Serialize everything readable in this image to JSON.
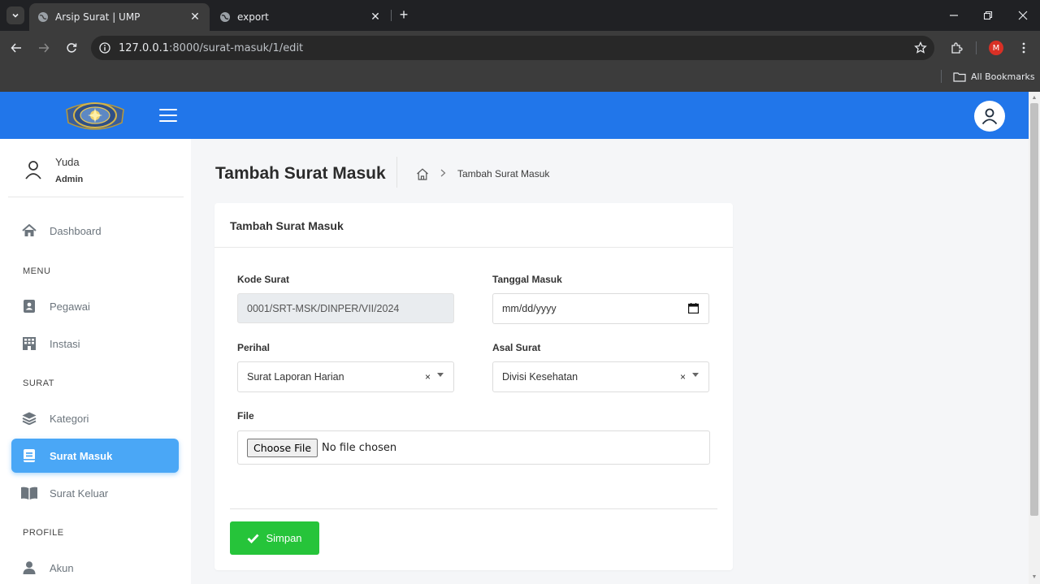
{
  "browser": {
    "tabs": [
      {
        "title": "Arsip Surat | UMP",
        "active": true
      },
      {
        "title": "export",
        "active": false
      }
    ],
    "url_host": "127.0.0.1",
    "url_rest": ":8000/surat-masuk/1/edit",
    "profile_initial": "M",
    "bookmarks_label": "All Bookmarks"
  },
  "sidebar": {
    "user_name": "Yuda",
    "user_role": "Admin",
    "items": {
      "dashboard": "Dashboard",
      "pegawai": "Pegawai",
      "instasi": "Instasi",
      "kategori": "Kategori",
      "surat_masuk": "Surat Masuk",
      "surat_keluar": "Surat Keluar",
      "akun": "Akun"
    },
    "headings": {
      "menu": "MENU",
      "surat": "SURAT",
      "profile": "PROFILE"
    }
  },
  "page": {
    "title": "Tambah Surat Masuk",
    "breadcrumb_current": "Tambah Surat Masuk"
  },
  "form": {
    "card_title": "Tambah Surat Masuk",
    "kode_label": "Kode Surat",
    "kode_value": "0001/SRT-MSK/DINPER/VII/2024",
    "tanggal_label": "Tanggal Masuk",
    "tanggal_placeholder": "mm/dd/yyyy",
    "perihal_label": "Perihal",
    "perihal_value": "Surat Laporan Harian",
    "asal_label": "Asal Surat",
    "asal_value": "Divisi Kesehatan",
    "file_label": "File",
    "choose_file": "Choose File",
    "no_file": "No file chosen",
    "save_label": "Simpan",
    "clear_symbol": "×"
  },
  "colors": {
    "topbar": "#2176ea",
    "active_item": "#4aa7f6",
    "save": "#26c43a"
  }
}
